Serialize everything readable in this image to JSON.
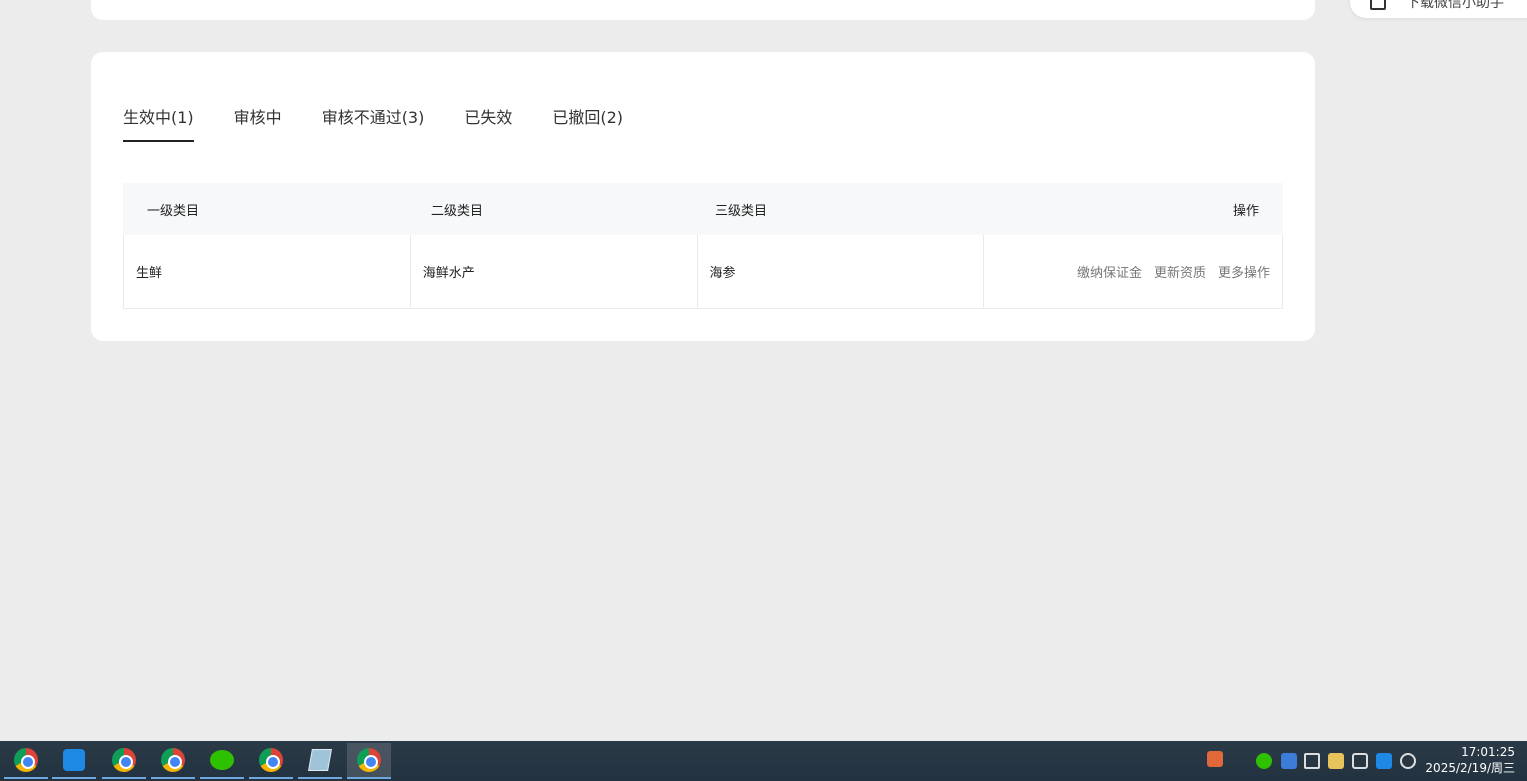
{
  "side_panel": {
    "text": "下载微信小助手"
  },
  "tabs": [
    {
      "label": "生效中(1)",
      "active": true
    },
    {
      "label": "审核中",
      "active": false
    },
    {
      "label": "审核不通过(3)",
      "active": false
    },
    {
      "label": "已失效",
      "active": false
    },
    {
      "label": "已撤回(2)",
      "active": false
    }
  ],
  "table": {
    "headers": [
      "一级类目",
      "二级类目",
      "三级类目",
      "操作"
    ],
    "rows": [
      {
        "cells": [
          "生鲜",
          "海鲜水产",
          "海参"
        ],
        "actions": [
          "缴纳保证金",
          "更新资质",
          "更多操作"
        ]
      }
    ]
  },
  "taskbar": {
    "apps": [
      "chrome-icon",
      "app-icon",
      "chrome-icon",
      "chrome-icon",
      "wechat-icon",
      "chrome-icon",
      "notepad-icon",
      "chrome-icon"
    ],
    "clock_time": "17:01:25",
    "clock_date": "2025/2/19/周三"
  },
  "colors": {
    "background": "#ececec",
    "card": "#ffffff",
    "taskbar": "#2b3a47",
    "link": "#777777"
  }
}
